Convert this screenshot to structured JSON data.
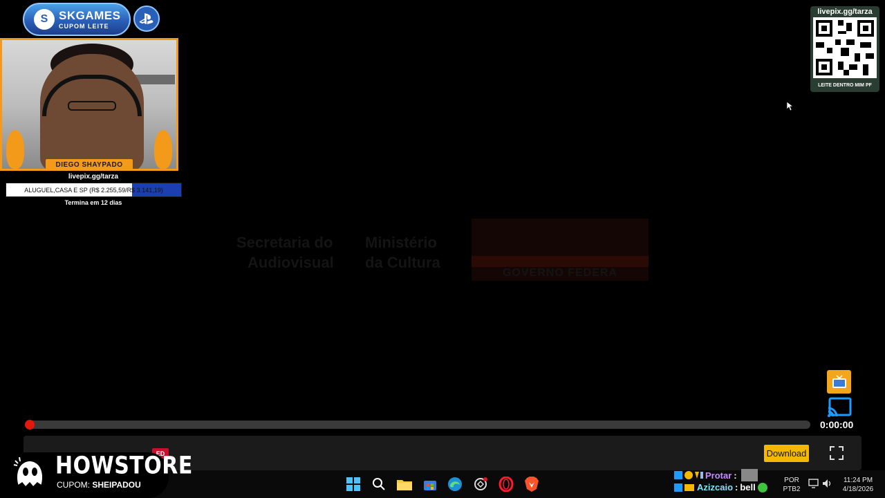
{
  "sponsor": {
    "title": "SKGAMES",
    "subtitle": "CUPOM LEITE"
  },
  "webcam": {
    "streamer_name": "DIEGO SHAYPADO"
  },
  "donation": {
    "url": "livepix.gg/tarza",
    "goal_text": "ALUGUEL,CASA E SP (R$ 2.255,59/R$ 3.141,19)",
    "goal_progress": 0.718,
    "deadline": "Termina em 12 dias"
  },
  "qr": {
    "url": "livepix.gg/tarza",
    "caption": "LEITE DENTRO MIM PF"
  },
  "watermark": {
    "secretaria": [
      "Secretaria do",
      "Audiovisual"
    ],
    "ministerio": [
      "Ministério",
      "da Cultura"
    ],
    "gov_label": "GOVERNO FEDERA"
  },
  "player": {
    "time": "0:00:00",
    "progress": 0,
    "download_label": "Download",
    "live_label": "ED"
  },
  "howstore": {
    "name": "HOWSTORE",
    "coupon_label": "CUPOM:",
    "coupon_code": "SHEIPADOU"
  },
  "chat": [
    {
      "user": "Protar",
      "message": ""
    },
    {
      "user": "Azizcaio",
      "message": "bell"
    }
  ],
  "tray": {
    "lang_top": "POR",
    "lang_bottom": "PTB2",
    "time": "11:24 PM",
    "date": "4/18/2026"
  },
  "colors": {
    "accent_orange": "#f39a1b",
    "seek_red": "#e3170a",
    "download_yellow": "#f5b800",
    "goal_blue": "#1c3fb0"
  }
}
